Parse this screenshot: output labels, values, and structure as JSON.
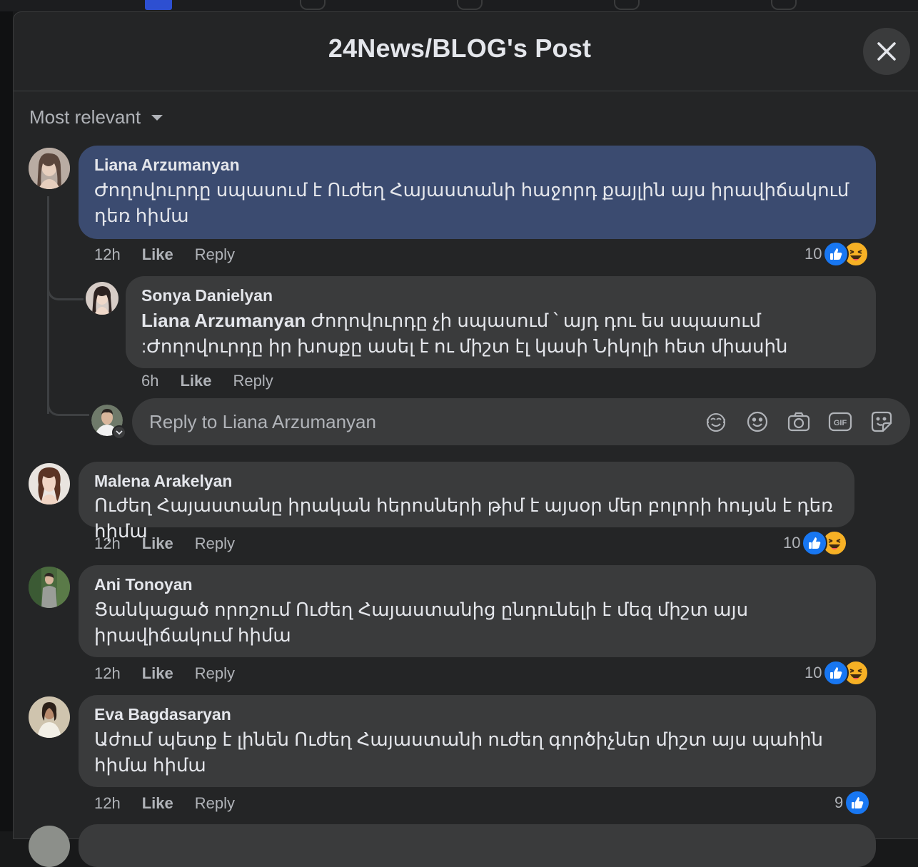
{
  "dialog": {
    "title": "24News/BLOG's Post"
  },
  "sort": {
    "label": "Most relevant"
  },
  "comments": [
    {
      "author": "Liana Arzumanyan",
      "text": "Ժողովուրդը սպասում է Ուժեղ Հայաստանի հաջորդ քայլին այս իրավիճակում դեռ հիմա",
      "time": "12h",
      "like": "Like",
      "reply": "Reply",
      "reactions": {
        "count": "10",
        "types": [
          "like-icon",
          "haha-icon"
        ]
      },
      "highlighted": true
    },
    {
      "author": "Malena Arakelyan",
      "text": "Ուժեղ Հայաստանը իրական հերոսների թիմ է այսօր մեր բոլորի հույսն է դեռ հիմա",
      "time": "12h",
      "like": "Like",
      "reply": "Reply",
      "reactions": {
        "count": "10",
        "types": [
          "like-icon",
          "haha-icon"
        ]
      }
    },
    {
      "author": "Ani Tonoyan",
      "text": "Ցանկացած որոշում Ուժեղ Հայաստանից ընդունելի է մեզ միշտ այս իրավիճակում հիմա",
      "time": "12h",
      "like": "Like",
      "reply": "Reply",
      "reactions": {
        "count": "10",
        "types": [
          "like-icon",
          "haha-icon"
        ]
      }
    },
    {
      "author": "Eva Bagdasaryan",
      "text": "Աժում պետք է լինեն Ուժեղ Հայաստանի ուժեղ գործիչներ միշտ այս պահին հիմա հիմա",
      "time": "12h",
      "like": "Like",
      "reply": "Reply",
      "reactions": {
        "count": "9",
        "types": [
          "like-icon"
        ]
      }
    }
  ],
  "reply": {
    "author": "Sonya Danielyan",
    "mention": "Liana Arzumanyan",
    "text": " Ժողովուրդը չի սպասում ՝ այդ դու ես սպասում :Ժողովուրդը իր խոսքը ասել է ու միշտ էլ կասի Նիկոլի հետ միասին",
    "time": "6h",
    "like": "Like",
    "reply": "Reply"
  },
  "reply_box": {
    "placeholder": "Reply to Liana Arzumanyan",
    "tools": [
      "avatar-sticker-icon",
      "emoji-icon",
      "camera-icon",
      "gif-icon",
      "sticker-icon"
    ]
  },
  "colors": {
    "background": "#242526",
    "bubble": "#3a3b3c",
    "bubble_highlight": "#3b4b70",
    "like_blue": "#1877f2",
    "haha_yellow": "#f7b125",
    "text_primary": "#e4e6eb",
    "text_secondary": "#b0b3b8"
  }
}
